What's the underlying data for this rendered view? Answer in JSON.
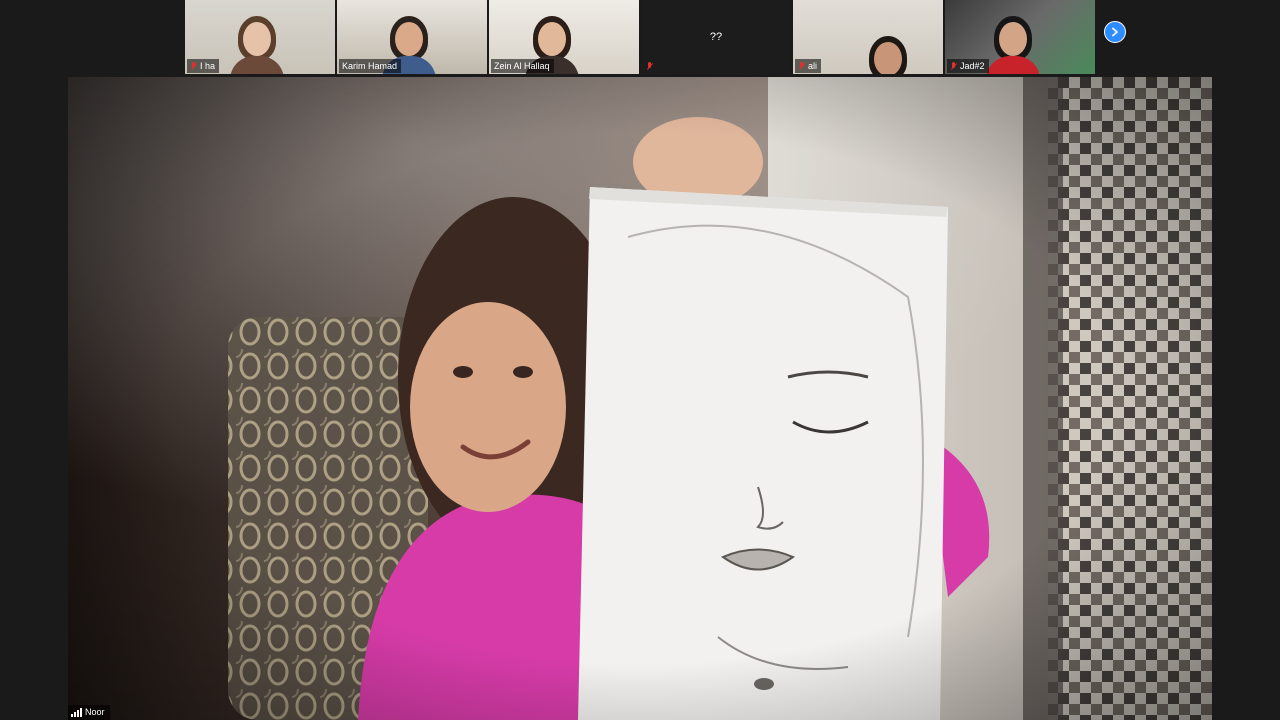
{
  "meeting": {
    "thumbnails": [
      {
        "name": "I ha",
        "muted": true
      },
      {
        "name": "Karim Hamad",
        "muted": false
      },
      {
        "name": "Zein Al Hallaq",
        "muted": false
      },
      {
        "name": "??",
        "muted": true,
        "video_off": true
      },
      {
        "name": "ali",
        "muted": true
      },
      {
        "name": "Jad#2",
        "muted": true
      }
    ],
    "next_page_icon": "chevron-right-icon",
    "active_speaker": {
      "name": "Noor",
      "signal_icon": "signal-bars-icon"
    },
    "colors": {
      "accent": "#2d8cff",
      "muted": "#e0302e",
      "background": "#1a1a1a"
    }
  }
}
